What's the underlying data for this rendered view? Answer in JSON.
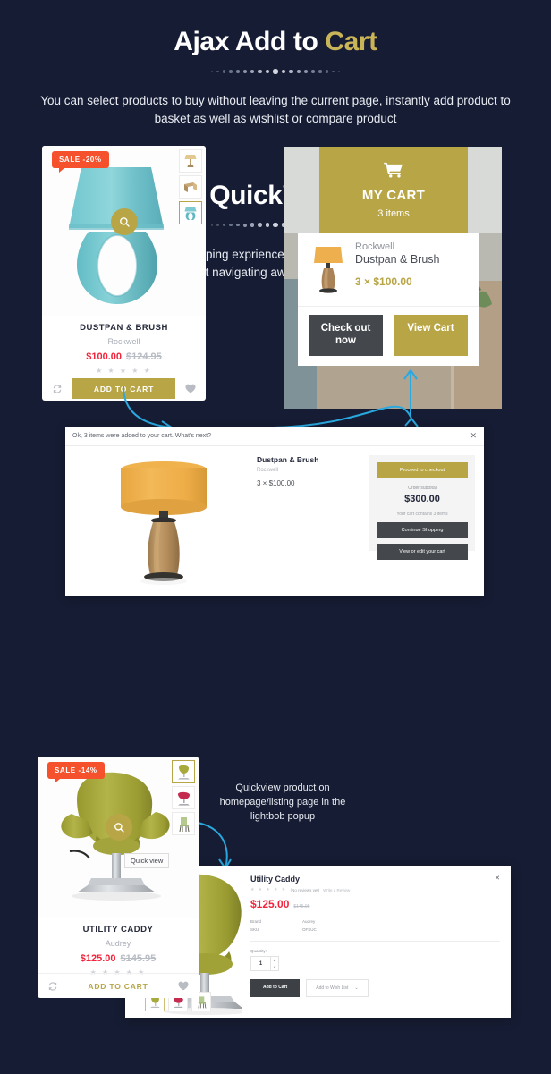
{
  "theme": {
    "bg": "#161c33",
    "gold": "#b8a546",
    "gold_text": "#c9b558",
    "gold_dark": "#9e8d3c",
    "sale_red": "#f4512c",
    "price_red": "#f3243b",
    "dark_btn": "#44484c",
    "arrow_blue": "#29a9e0"
  },
  "section_ajax": {
    "title_white": "Ajax Add to ",
    "title_accent": "Cart",
    "subtitle": "You can select products to buy without leaving the current page, instantly add product to basket as well as wishlist or compare product"
  },
  "product_card_lamp": {
    "badge": "SALE -20%",
    "name": "DUSTPAN & BRUSH",
    "brand": "Rockwell",
    "price": "$100.00",
    "old_price": "$124.95",
    "stars": "★ ★ ★ ★ ★",
    "add_to_cart": "ADD TO CART",
    "compare_icon": "compare-icon",
    "wishlist_icon": "heart-icon",
    "zoom_icon": "magnifier-icon",
    "thumbnails": [
      "lamp-tan-thumb",
      "wooden-stool-thumb",
      "lamp-teal-thumb"
    ]
  },
  "cart_panel": {
    "cart_icon": "shopping-cart-icon",
    "title": "MY CART",
    "items_count": "3 items",
    "item": {
      "brand": "Rockwell",
      "name": "Dustpan & Brush",
      "qty_price": "3 × $100.00",
      "thumb": "lamp-orange-thumb"
    },
    "checkout_label": "Check out now",
    "view_cart_label": "View Cart"
  },
  "lightbox_cart": {
    "header_text": "Ok, 3 items were added to your cart. What's next?",
    "close_icon": "close-icon",
    "product_name": "Dustpan & Brush",
    "product_brand": "Rockwell",
    "product_qty_price": "3 × $100.00",
    "proceed_label": "Proceed to checkout",
    "subtotal_label": "Order subtotal",
    "subtotal_value": "$300.00",
    "contains_text": "Your cart contains 3 items",
    "continue_label": "Continue Shopping",
    "view_edit_label": "View or edit your cart",
    "image": "orange-table-lamp"
  },
  "section_quickview": {
    "title_white": "Quick",
    "title_accent": "View",
    "subtitle": "For a more convenient shopping exprience, users can view the product details in a popup, without navigating away from the current page."
  },
  "product_card_chair": {
    "badge": "SALE -14%",
    "name": "UTILITY CADDY",
    "brand": "Audrey",
    "price": "$125.00",
    "old_price": "$145.95",
    "stars": "★ ★ ★ ★ ★",
    "add_to_cart": "ADD TO CART",
    "quick_view_tooltip": "Quick view",
    "compare_icon": "compare-icon",
    "wishlist_icon": "heart-icon",
    "zoom_icon": "magnifier-icon",
    "thumbnails": [
      "chair-olive-thumb",
      "chair-pink-thumb",
      "chair-green-thumb"
    ]
  },
  "annotation_quickview": "Quickview product on homepage/listing page in the lightbob popup",
  "quickview_popup": {
    "title": "Utility Caddy",
    "stars": "★ ★ ★ ★ ★",
    "no_reviews": "(No reviews yet)",
    "write_review": "Write a Review",
    "price": "$125.00",
    "old_price": "$145.95",
    "brand_label": "Brand",
    "brand_value": "Audrey",
    "sku_label": "SKU",
    "sku_value": "OFSUC",
    "quantity_label": "Quantity:",
    "quantity_value": "1",
    "stepper_up": "▲",
    "stepper_down": "▼",
    "add_to_cart": "Add to Cart",
    "wishlist": "Add to Wish List",
    "wishlist_caret": "⌄",
    "close_icon": "close-icon",
    "thumbnails": [
      "chair-olive-thumb",
      "chair-pink-thumb",
      "chair-green-thumb"
    ],
    "main_image": "olive-swan-chair"
  }
}
